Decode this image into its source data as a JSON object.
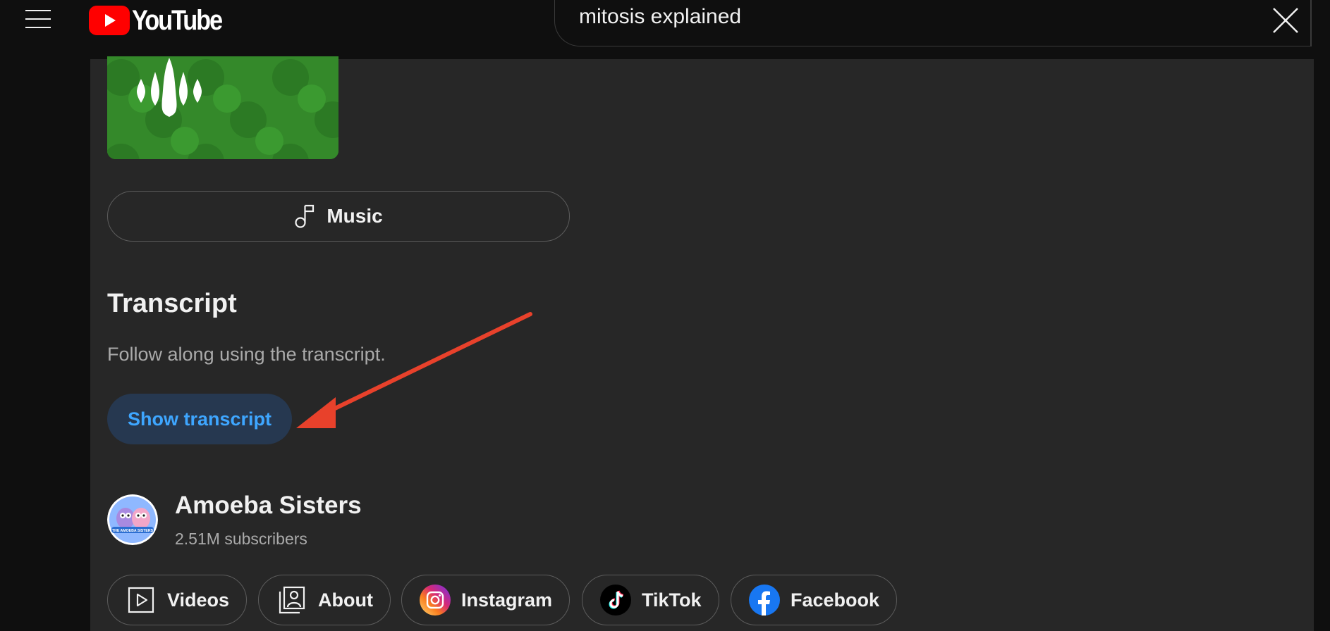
{
  "header": {
    "logo_text": "YouTube",
    "search_query": "mitosis explained"
  },
  "music_button": {
    "label": "Music"
  },
  "transcript": {
    "title": "Transcript",
    "description": "Follow along using the transcript.",
    "button_label": "Show transcript"
  },
  "channel": {
    "name": "Amoeba Sisters",
    "subscribers": "2.51M subscribers",
    "avatar_text": "THE AMOEBA SISTERS"
  },
  "links": [
    {
      "label": "Videos",
      "icon": "video-play-icon"
    },
    {
      "label": "About",
      "icon": "portrait-icon"
    },
    {
      "label": "Instagram",
      "icon": "instagram-icon"
    },
    {
      "label": "TikTok",
      "icon": "tiktok-icon"
    },
    {
      "label": "Facebook",
      "icon": "facebook-icon"
    }
  ],
  "colors": {
    "background": "#0f0f0f",
    "panel": "#272727",
    "youtube_red": "#ff0000",
    "accent_blue": "#3ea6ff",
    "transcript_button_bg": "#263850",
    "annotation_arrow": "#e8412b",
    "thumbnail_green": "#34892a"
  }
}
